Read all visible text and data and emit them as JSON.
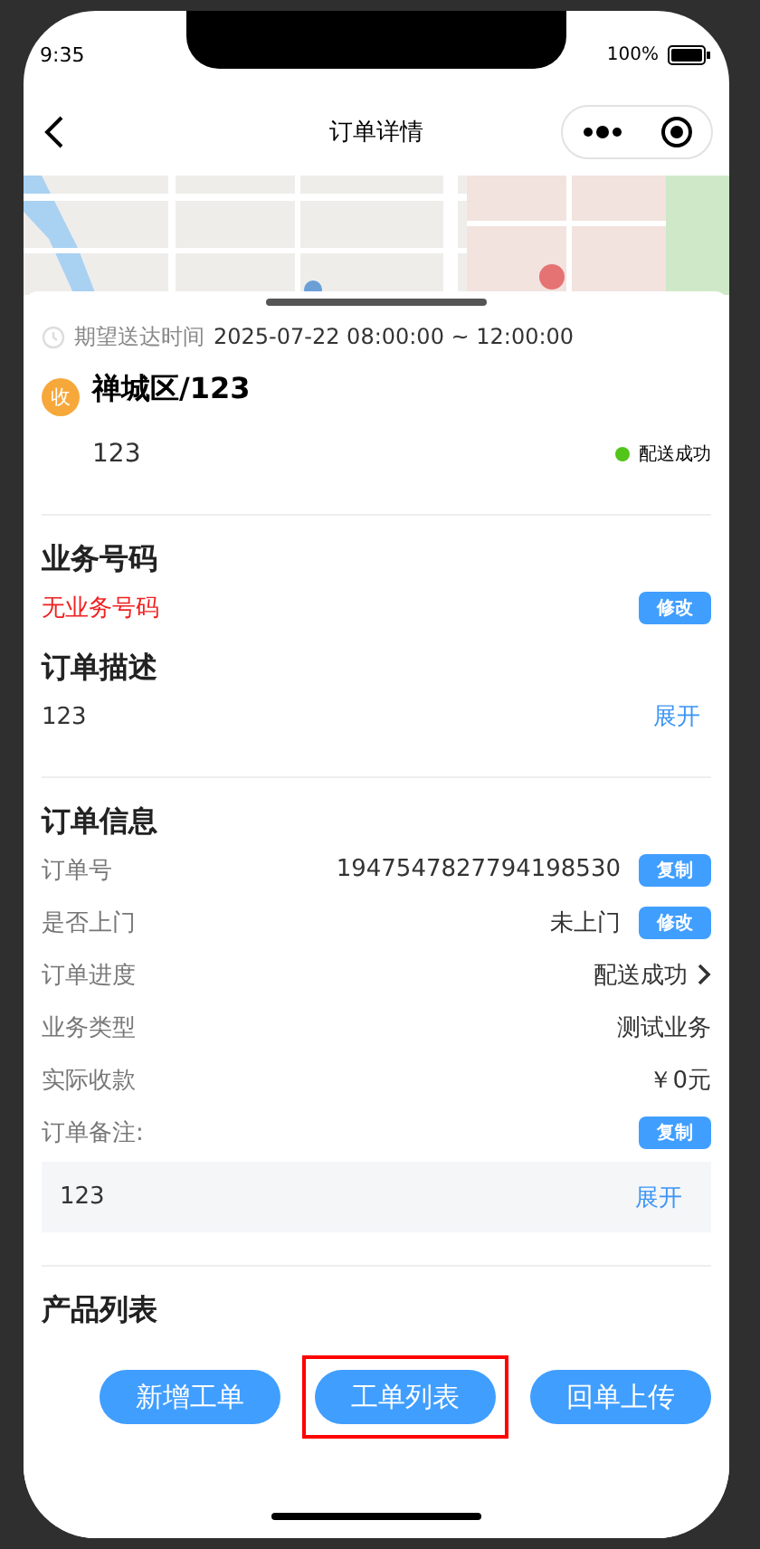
{
  "status_bar": {
    "time": "9:35",
    "battery": "100%"
  },
  "nav": {
    "title": "订单详情"
  },
  "delivery": {
    "time_label": "期望送达时间",
    "time_value": "2025-07-22 08:00:00 ~ 12:00:00",
    "badge": "收",
    "address": "禅城区/123",
    "detail": "123",
    "status": "配送成功"
  },
  "business": {
    "title": "业务号码",
    "value": "无业务号码",
    "button": "修改"
  },
  "description": {
    "title": "订单描述",
    "value": "123",
    "expand": "展开"
  },
  "order_info": {
    "title": "订单信息",
    "rows": [
      {
        "kind": "button",
        "label": "订单号",
        "value": "1947547827794198530",
        "button": "复制"
      },
      {
        "kind": "button",
        "label": "是否上门",
        "value": "未上门",
        "button": "修改"
      },
      {
        "kind": "link",
        "label": "订单进度",
        "value": "配送成功"
      },
      {
        "kind": "plain",
        "label": "业务类型",
        "value": "测试业务"
      },
      {
        "kind": "plain",
        "label": "实际收款",
        "value": "￥0元"
      },
      {
        "kind": "button",
        "label": "订单备注:",
        "button": "复制"
      }
    ],
    "note": {
      "value": "123",
      "expand": "展开"
    }
  },
  "products": {
    "title": "产品列表"
  },
  "buttons": [
    {
      "label": "新增工单",
      "highlighted": false
    },
    {
      "label": "工单列表",
      "highlighted": true
    },
    {
      "label": "回单上传",
      "highlighted": false
    }
  ]
}
